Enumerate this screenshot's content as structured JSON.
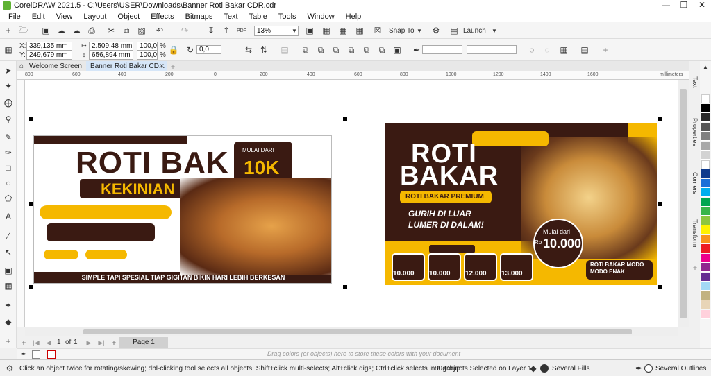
{
  "window": {
    "title": "CorelDRAW 2021.5 - C:\\Users\\USER\\Downloads\\Banner Roti Bakar CDR.cdr"
  },
  "menu": [
    "File",
    "Edit",
    "View",
    "Layout",
    "Object",
    "Effects",
    "Bitmaps",
    "Text",
    "Table",
    "Tools",
    "Window",
    "Help"
  ],
  "standard": {
    "zoom": "13%",
    "snap_label": "Snap To",
    "launch_label": "Launch"
  },
  "property": {
    "x_label": "X:",
    "x_value": "339,135 mm",
    "y_label": "Y:",
    "y_value": "249,679 mm",
    "w_value": "2.509,48 mm",
    "h_value": "656,894 mm",
    "sx_value": "100,0",
    "sy_value": "100,0",
    "pct": "%",
    "angle_value": "0,0"
  },
  "tabs": [
    {
      "label": "Welcome Screen"
    },
    {
      "label": "Banner Roti Bakar CD..."
    }
  ],
  "ruler": {
    "unit": "millimeters",
    "ticks": [
      "800",
      "600",
      "400",
      "200",
      "0",
      "200",
      "400",
      "600",
      "800",
      "1000",
      "1200",
      "1400",
      "1600",
      "1800"
    ]
  },
  "page_nav": {
    "current": "1",
    "of": "of",
    "total": "1",
    "page_tab": "Page 1"
  },
  "tray": {
    "hint": "Drag colors (or objects) here to store these colors with your document"
  },
  "status": {
    "hint": "Click an object twice for rotating/skewing; dbl-clicking tool selects all objects; Shift+click multi-selects; Alt+click digs; Ctrl+click selects in a group",
    "selection": "80 Objects Selected on Layer 1",
    "fill": "Several Fills",
    "outline": "Several Outlines"
  },
  "dockers": [
    "Text",
    "Properties",
    "Corners",
    "Transform"
  ],
  "banner1": {
    "title": "ROTI BAK",
    "sub": "KEKINIAN",
    "from": "MULAI DARI",
    "price": "10K",
    "footer": "SIMPLE TAPI SPESIAL TIAP GIGITAN BIKIN HARI LEBIH BERKESAN"
  },
  "banner2": {
    "title1": "ROTI",
    "title2": "BAKAR",
    "premium": "ROTI BAKAR PREMIUM",
    "tag1": "GURIH DI LUAR",
    "tag2": "LUMER DI DALAM!",
    "from": "Mulai dari",
    "price": "10.000",
    "prices": [
      "10.000",
      "10.000",
      "12.000",
      "13.000"
    ],
    "currency": "Rp",
    "tagline": "ROTI BAKAR MODO MODO ENAK"
  },
  "colors": {
    "brand_dark": "#3a1a12",
    "brand_yellow": "#f5b800",
    "accent_green": "#5fb233",
    "selection_blue": "#d6e6f8"
  },
  "palette": [
    "#ffffff",
    "#000000",
    "#2a2a2a",
    "#555555",
    "#808080",
    "#a9a9a9",
    "#d3d3d3",
    "#ffffff",
    "#0f3a8c",
    "#1b6fd8",
    "#00aeef",
    "#00a651",
    "#39b54a",
    "#8dc63f",
    "#fff200",
    "#f7941d",
    "#ed1c24",
    "#ec008c",
    "#92278f",
    "#662d91",
    "#a3d9f5",
    "#c2b280",
    "#e8d5b7",
    "#ffd1dc"
  ]
}
